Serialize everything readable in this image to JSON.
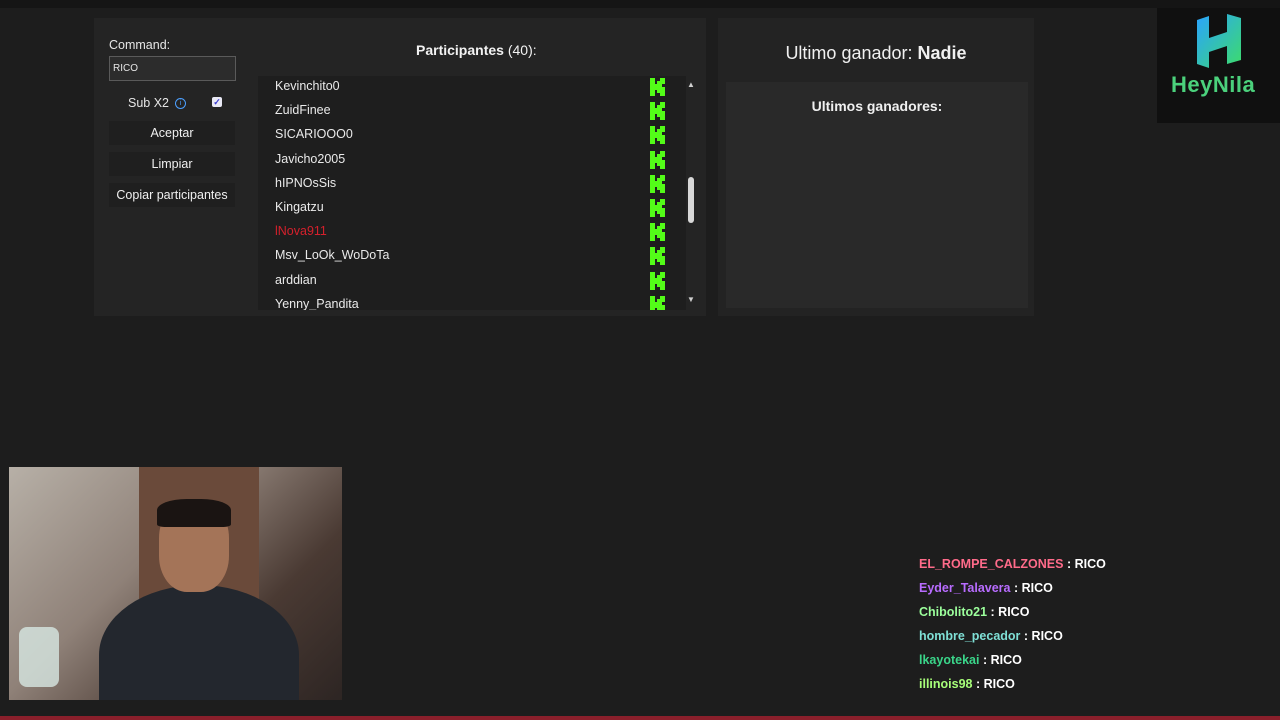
{
  "command": {
    "label": "Command:",
    "value": "RICO"
  },
  "sub": {
    "label": "Sub X2",
    "checked": true
  },
  "buttons": {
    "aceptar": "Aceptar",
    "limpiar": "Limpiar",
    "copiar": "Copiar participantes"
  },
  "participants": {
    "title": "Participantes",
    "count": "(40):",
    "items": [
      {
        "name": "Kevinchito0",
        "highlight": false
      },
      {
        "name": "ZuidFinee",
        "highlight": false
      },
      {
        "name": "SICARIOOO0",
        "highlight": false
      },
      {
        "name": "Javicho2005",
        "highlight": false
      },
      {
        "name": "hIPNOsSis",
        "highlight": false
      },
      {
        "name": "Kingatzu",
        "highlight": false
      },
      {
        "name": "lNova911",
        "highlight": true
      },
      {
        "name": "Msv_LoOk_WoDoTa",
        "highlight": false
      },
      {
        "name": "arddian",
        "highlight": false
      },
      {
        "name": "Yenny_Pandita",
        "highlight": false
      }
    ]
  },
  "winner": {
    "label": "Ultimo ganador:",
    "name": "Nadie"
  },
  "last_winners": {
    "title": "Ultimos ganadores:"
  },
  "logo": {
    "text": "HeyNila"
  },
  "chat": [
    {
      "user": "EL_ROMPE_CALZONES",
      "msg": ": RICO",
      "color": "#ff6b8a"
    },
    {
      "user": "Eyder_Talavera",
      "msg": ": RICO",
      "color": "#b86cff"
    },
    {
      "user": "Chibolito21",
      "msg": ": RICO",
      "color": "#9cff9c"
    },
    {
      "user": "hombre_pecador",
      "msg": ": RICO",
      "color": "#7fe0d6"
    },
    {
      "user": "lkayotekai",
      "msg": ": RICO",
      "color": "#3ad68a"
    },
    {
      "user": "illinois98",
      "msg": ": RICO",
      "color": "#a8ff7a"
    }
  ]
}
